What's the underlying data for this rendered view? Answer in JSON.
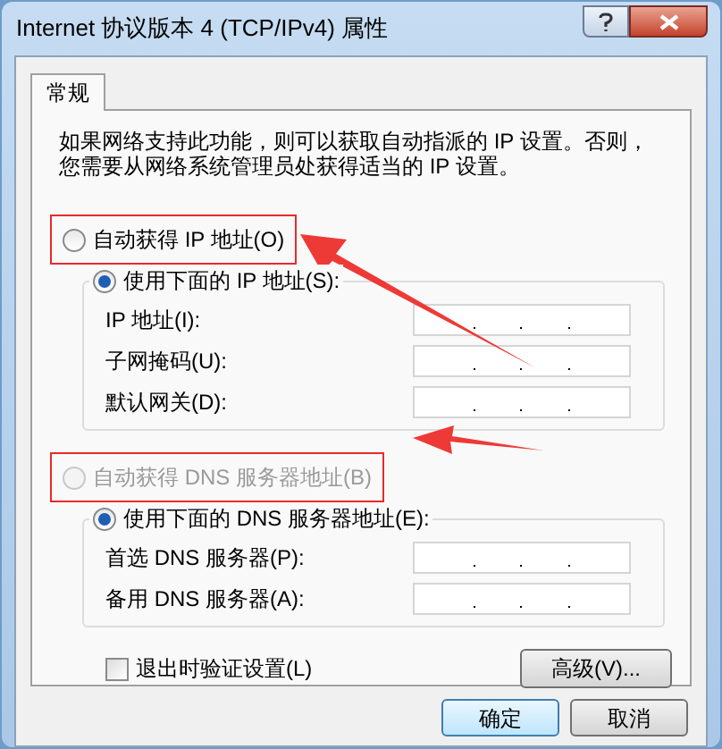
{
  "window": {
    "title": "Internet 协议版本 4 (TCP/IPv4) 属性"
  },
  "tabs": [
    {
      "label": "常规",
      "selected": true
    }
  ],
  "description": [
    "如果网络支持此功能，则可以获取自动指派的 IP 设置。否则，",
    "您需要从网络系统管理员处获得适当的 IP 设置。"
  ],
  "ip_section": {
    "auto_option": {
      "label": "自动获得 IP 地址(O)",
      "selected": false,
      "disabled": false,
      "highlighted": true
    },
    "manual_option": {
      "label": "使用下面的 IP 地址(S):",
      "selected": true
    },
    "fields": [
      {
        "label": "IP 地址(I):"
      },
      {
        "label": "子网掩码(U):"
      },
      {
        "label": "默认网关(D):"
      }
    ]
  },
  "dns_section": {
    "auto_option": {
      "label": "自动获得 DNS 服务器地址(B)",
      "selected": false,
      "disabled": true,
      "highlighted": true
    },
    "manual_option": {
      "label": "使用下面的 DNS 服务器地址(E):",
      "selected": true
    },
    "fields": [
      {
        "label": "首选 DNS 服务器(P):"
      },
      {
        "label": "备用 DNS 服务器(A):"
      }
    ]
  },
  "validate_checkbox": {
    "label": "退出时验证设置(L)",
    "checked": false
  },
  "advanced_button": "高级(V)...",
  "buttons": [
    {
      "label": "确定",
      "kind": "default"
    },
    {
      "label": "取消",
      "kind": "normal"
    }
  ]
}
